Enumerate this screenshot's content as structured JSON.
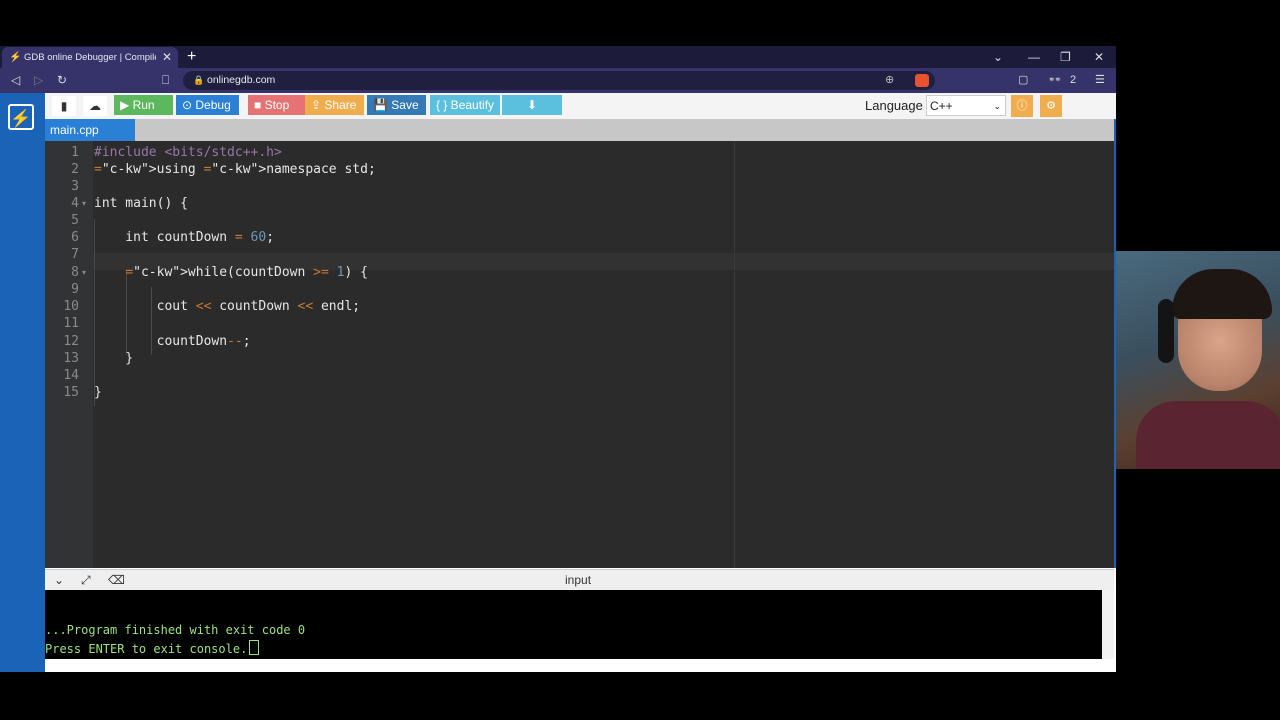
{
  "browser": {
    "tab_title": "GDB online Debugger | Compiler",
    "new_tab_label": "+",
    "url": "onlinegdb.com",
    "tab_count": "2"
  },
  "ide": {
    "buttons": {
      "run": "Run",
      "debug": "Debug",
      "stop": "Stop",
      "share": "Share",
      "save": "Save",
      "beautify": "{ } Beautify"
    },
    "language_label": "Language",
    "language_value": "C++",
    "file_tab": "main.cpp",
    "code_lines": [
      {
        "n": "1",
        "code": "#include <bits/stdc++.h>"
      },
      {
        "n": "2",
        "code": "using namespace std;"
      },
      {
        "n": "3",
        "code": ""
      },
      {
        "n": "4",
        "code": "int main() {"
      },
      {
        "n": "5",
        "code": ""
      },
      {
        "n": "6",
        "code": "    int countDown = 60;"
      },
      {
        "n": "7",
        "code": ""
      },
      {
        "n": "8",
        "code": "    while(countDown >= 1) {"
      },
      {
        "n": "9",
        "code": ""
      },
      {
        "n": "10",
        "code": "        cout << countDown << endl;"
      },
      {
        "n": "11",
        "code": ""
      },
      {
        "n": "12",
        "code": "        countDown--;"
      },
      {
        "n": "13",
        "code": "    }"
      },
      {
        "n": "14",
        "code": ""
      },
      {
        "n": "15",
        "code": "}"
      }
    ]
  },
  "console": {
    "title": "input",
    "lines": [
      "",
      "...Program finished with exit code 0",
      "Press ENTER to exit console."
    ]
  },
  "colors": {
    "sidebar": "#1a63b7",
    "run": "#5cb85c",
    "debug": "#2a80d5",
    "stop": "#e57373",
    "share": "#f0ad4e",
    "save": "#337ab7",
    "beautify": "#5bc0de",
    "console_text": "#9be37a"
  },
  "icons": [
    "new-file-icon",
    "upload-icon",
    "play-icon",
    "debug-icon",
    "stop-icon",
    "share-icon",
    "save-icon",
    "download-icon",
    "info-icon",
    "gear-icon",
    "bolt-logo-icon"
  ]
}
